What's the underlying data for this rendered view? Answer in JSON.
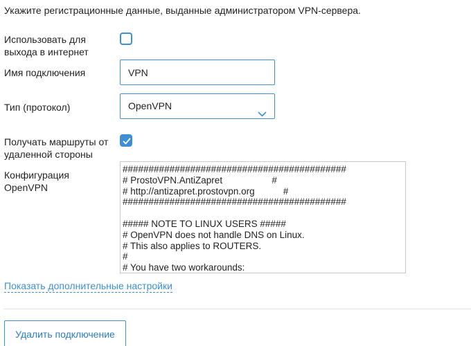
{
  "intro": "Укажите регистрационные данные, выданные администратором VPN-сервера.",
  "internet": {
    "label_line1": "Использовать для",
    "label_line2": "выхода в интернет",
    "checked": false
  },
  "connection_name": {
    "label": "Имя подключения",
    "value": "VPN"
  },
  "protocol": {
    "label": "Тип (протокол)",
    "value": "OpenVPN",
    "icon": "chevron-down-icon"
  },
  "routes": {
    "label_line1": "Получать маршруты от",
    "label_line2": "удаленной стороны",
    "checked": true,
    "icon": "check-icon"
  },
  "config": {
    "label_line1": "Конфигурация",
    "label_line2": "OpenVPN",
    "lines": [
      "###########################################",
      "# ProstoVPN.AntiZapret                   #",
      "# http://antizapret.prostovpn.org           #",
      "###########################################",
      "",
      "##### NOTE TO LINUX USERS #####",
      "# OpenVPN does not handle DNS on Linux.",
      "# This also applies to ROUTERS.",
      "#",
      "# You have two workarounds:"
    ]
  },
  "advanced_link": "Показать дополнительные настройки",
  "delete_button": "Удалить подключение",
  "colors": {
    "accent": "#3d8fd6",
    "text": "#222222",
    "border": "#c9c9c9"
  }
}
